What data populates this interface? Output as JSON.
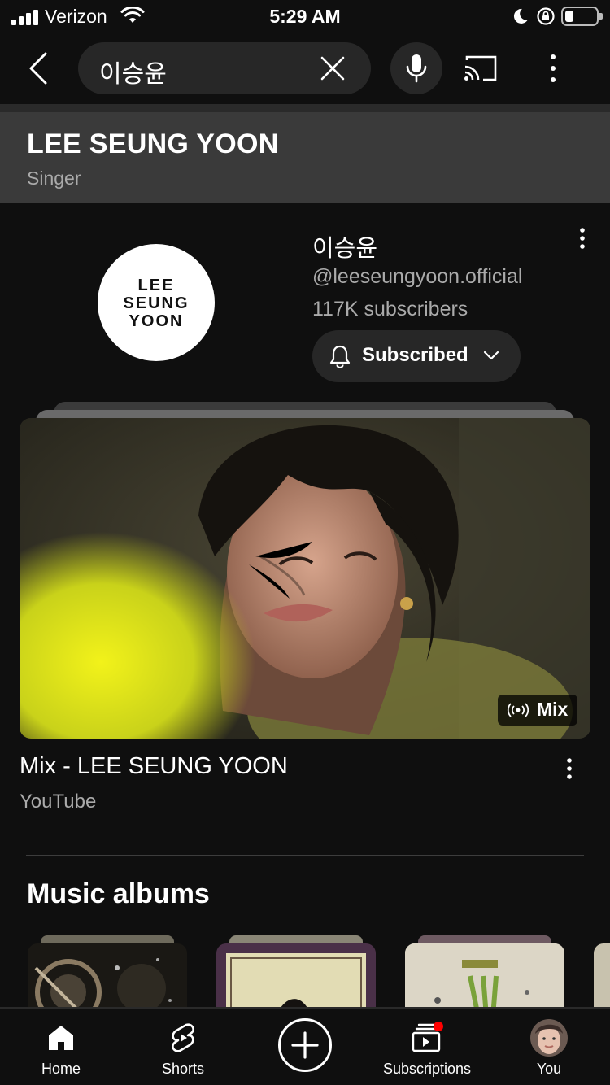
{
  "status_bar": {
    "carrier": "Verizon",
    "time": "5:29 AM",
    "battery_level": 0.2
  },
  "search": {
    "query": "이승윤",
    "icons": [
      "back-arrow-icon",
      "clear-icon",
      "microphone-icon",
      "cast-icon",
      "more-vertical-icon"
    ]
  },
  "knowledge_panel": {
    "title": "LEE SEUNG YOON",
    "subtitle": "Singer"
  },
  "channel": {
    "avatar_lines": [
      "LEE",
      "SEUNG",
      "YOON"
    ],
    "name": "이승윤",
    "handle": "@leeseungyoon.official",
    "subscribers": "117K subscribers",
    "subscribe_button": "Subscribed"
  },
  "mix": {
    "badge": "Mix",
    "title": "Mix - LEE SEUNG YOON",
    "channel": "YouTube"
  },
  "albums": {
    "section_title": "Music albums"
  },
  "bottom_nav": {
    "items": [
      {
        "label": "Home",
        "icon": "home-icon"
      },
      {
        "label": "Shorts",
        "icon": "shorts-icon"
      },
      {
        "label": "",
        "icon": "create-icon"
      },
      {
        "label": "Subscriptions",
        "icon": "subscriptions-icon"
      },
      {
        "label": "You",
        "icon": "profile-avatar"
      }
    ]
  },
  "colors": {
    "background": "#0f0f0f",
    "surface": "#272727",
    "panel": "#3a3a3a",
    "secondary_text": "#aaaaaa",
    "notification_dot": "#ff0000"
  }
}
